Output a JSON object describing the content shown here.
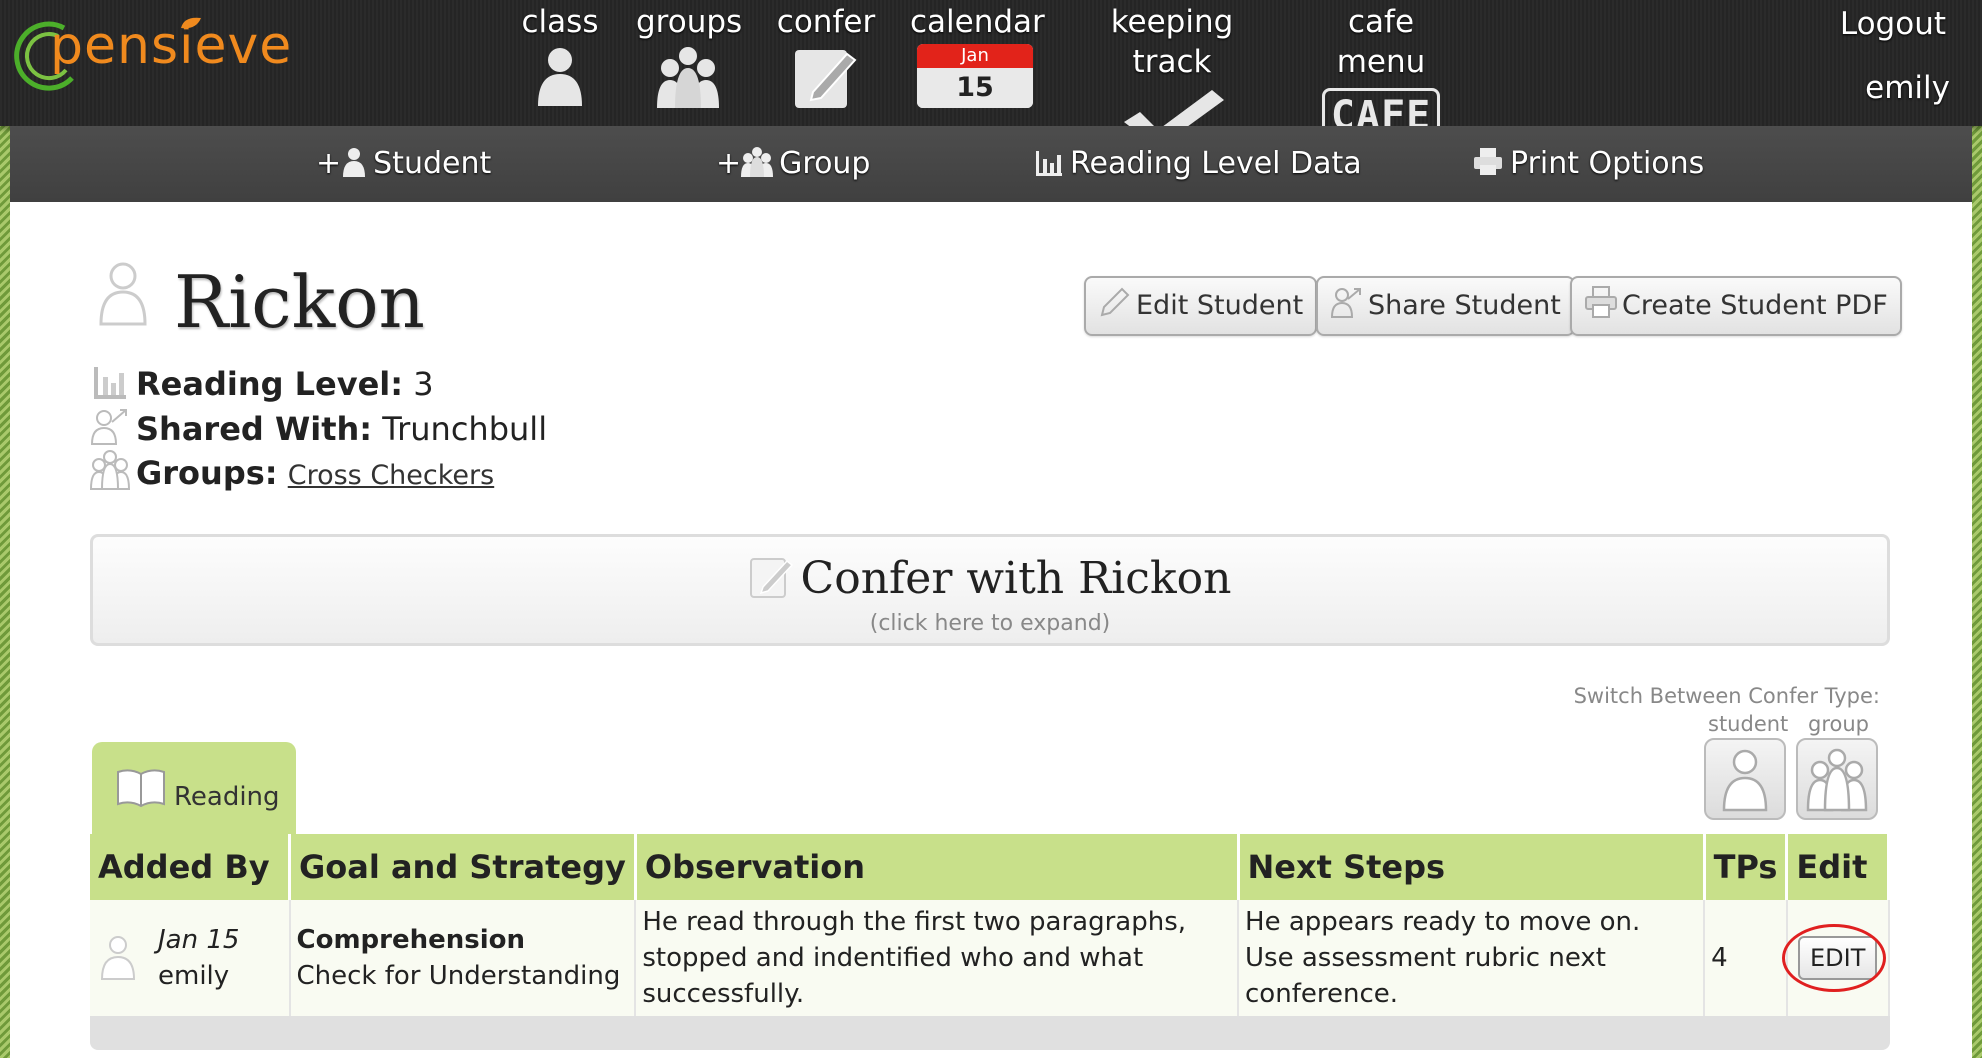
{
  "topnav": {
    "logo_text": "pensieve",
    "items": [
      {
        "label": "class",
        "icon": "person-icon"
      },
      {
        "label": "groups",
        "icon": "group-icon"
      },
      {
        "label": "confer",
        "icon": "notepad-icon"
      },
      {
        "label": "calendar",
        "icon": "calendar-icon",
        "month": "Jan",
        "day": "15"
      },
      {
        "label": "keeping track",
        "icon": "checkmark-icon"
      },
      {
        "label": "cafe menu",
        "icon": "cafe-icon",
        "badge": "CAFE"
      }
    ],
    "logout": "Logout",
    "username": "emily"
  },
  "subnav": {
    "items": [
      {
        "prefix": "+",
        "label": "Student",
        "icon": "person-icon"
      },
      {
        "prefix": "+",
        "label": "Group",
        "icon": "group-icon"
      },
      {
        "prefix": "",
        "label": "Reading Level Data",
        "icon": "bar-chart-icon"
      },
      {
        "prefix": "",
        "label": "Print Options",
        "icon": "printer-icon"
      }
    ]
  },
  "student": {
    "name": "Rickon",
    "reading_level_label": "Reading Level:",
    "reading_level": "3",
    "shared_with_label": "Shared With:",
    "shared_with": "Trunchbull",
    "groups_label": "Groups:",
    "group_link": "Cross Checkers"
  },
  "actions": {
    "edit": "Edit Student",
    "share": "Share Student",
    "pdf": "Create Student PDF"
  },
  "confer_panel": {
    "title": "Confer with Rickon",
    "subtitle": "(click here to expand)"
  },
  "switch": {
    "label": "Switch Between Confer Type:",
    "student": "student",
    "group": "group"
  },
  "tab": {
    "label": "Reading"
  },
  "table": {
    "headers": [
      "Added By",
      "Goal and Strategy",
      "Observation",
      "Next Steps",
      "TPs",
      "Edit"
    ],
    "rows": [
      {
        "date": "Jan 15",
        "author": "emily",
        "goal": "Comprehension",
        "strategy": "Check for Understanding",
        "observation": "He read through the first two paragraphs, stopped and indentified who and what successfully.",
        "next_steps": "He appears ready to move on. Use assessment rubric next conference.",
        "tps": "4",
        "edit_label": "EDIT"
      }
    ]
  },
  "colors": {
    "accent_green": "#c8e08a",
    "logo_orange": "#f08a1e",
    "calendar_red": "#e2231a",
    "highlight_ring": "#e02020"
  }
}
